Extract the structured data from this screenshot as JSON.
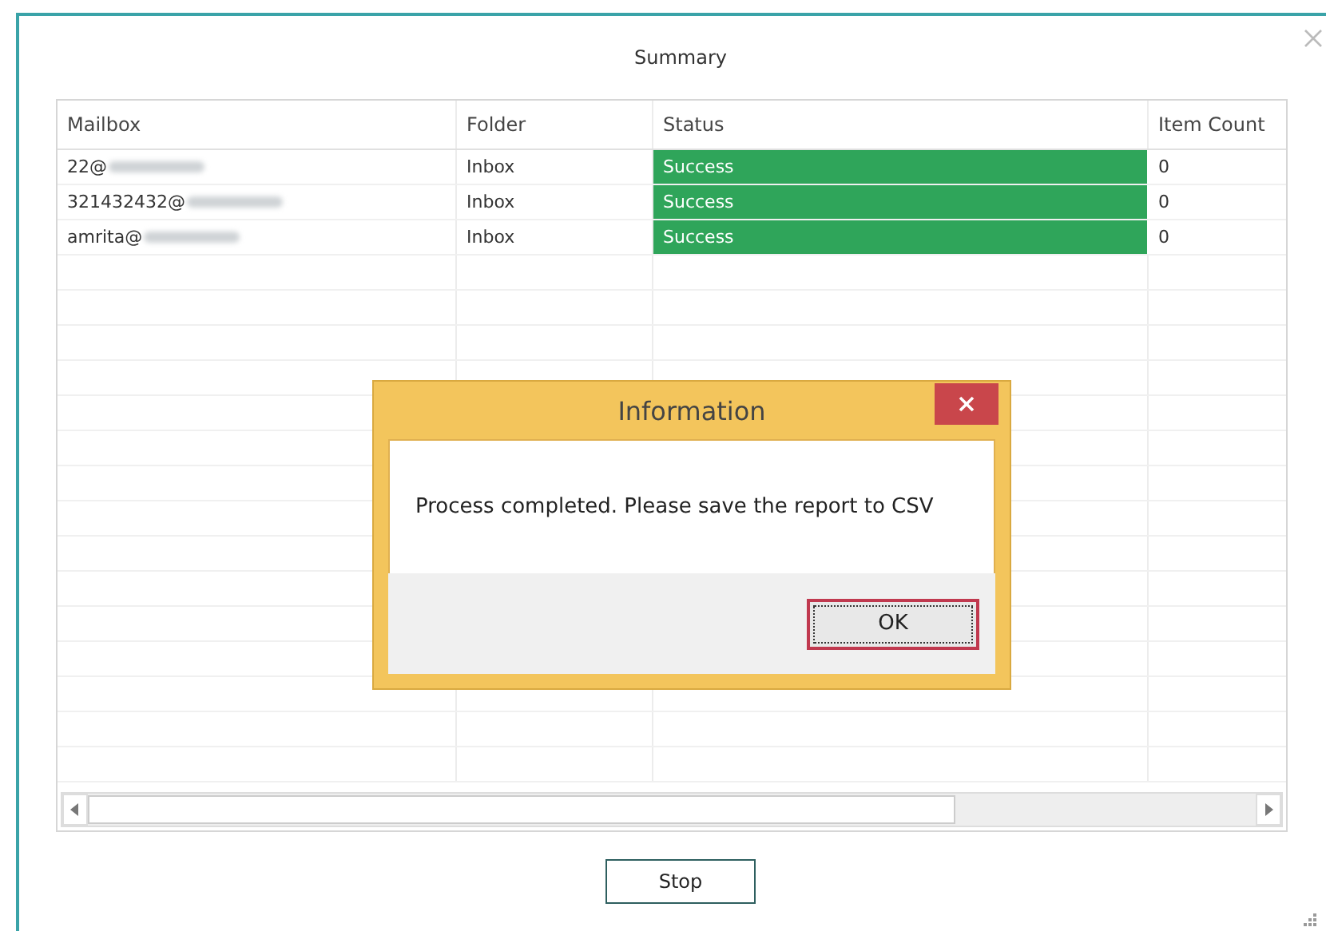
{
  "window": {
    "title": "Summary"
  },
  "table": {
    "columns": [
      "Mailbox",
      "Folder",
      "Status",
      "Item Count"
    ],
    "rows": [
      {
        "mailbox": "22@",
        "folder": "Inbox",
        "status": "Success",
        "item_count": "0",
        "color": "#2fa55a"
      },
      {
        "mailbox": "321432432@",
        "folder": "Inbox",
        "status": "Success",
        "item_count": "0",
        "color": "#2fa55a"
      },
      {
        "mailbox": "amrita@",
        "folder": "Inbox",
        "status": "Success",
        "item_count": "0",
        "color": "#2fa55a"
      }
    ]
  },
  "buttons": [
    "Stop"
  ],
  "dialog": {
    "title": "Information",
    "message": "Process completed. Please save the report to CSV",
    "button": "OK"
  }
}
